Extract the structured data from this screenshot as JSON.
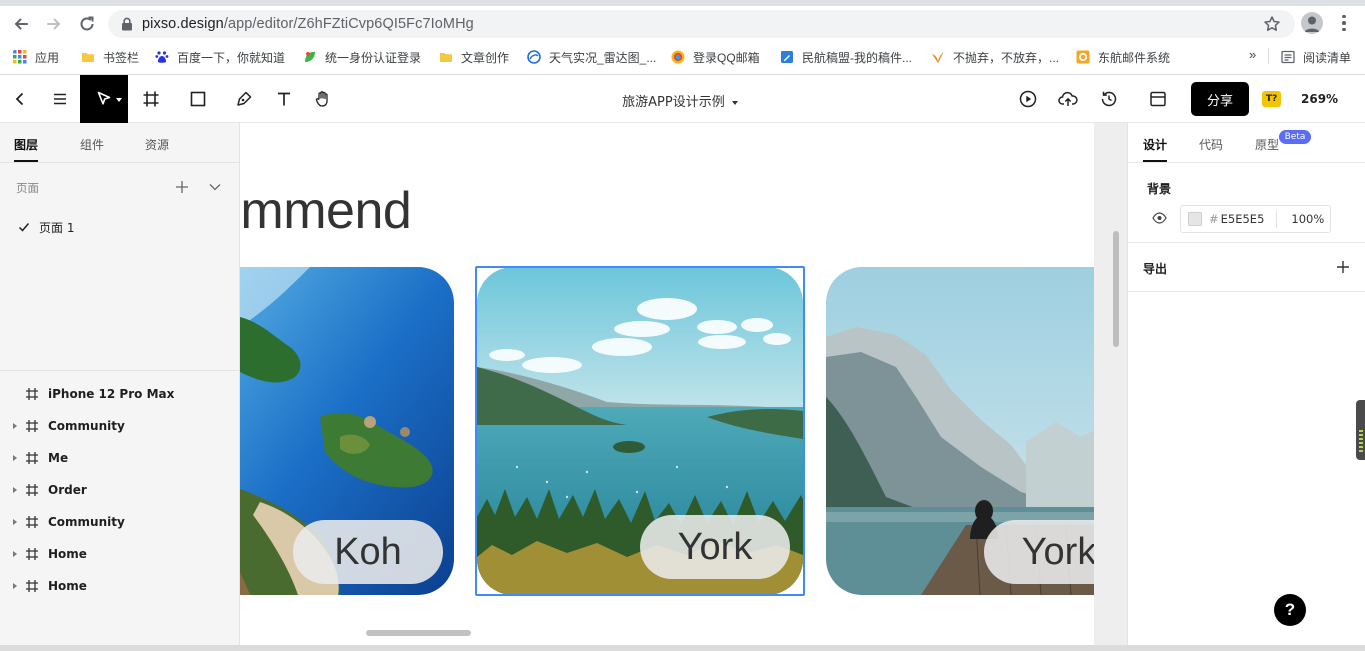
{
  "browser": {
    "url_host": "pixso.design",
    "url_path": "/app/editor/Z6hFZtiCvp6QI5Fc7IoMHg",
    "bookmarks": [
      {
        "label": "应用",
        "icon": "apps-grid-icon",
        "color": "#4285f4"
      },
      {
        "label": "书签栏",
        "icon": "folder-icon",
        "color": "#f5c842"
      },
      {
        "label": "百度一下，你就知道",
        "icon": "baidu-paw-icon",
        "color": "#2932e1"
      },
      {
        "label": "统一身份认证登录",
        "icon": "leaf-icon",
        "color": "#3bb54a"
      },
      {
        "label": "文章创作",
        "icon": "folder-icon",
        "color": "#f5c842"
      },
      {
        "label": "天气实况_雷达图_...",
        "icon": "weather-globe-icon",
        "color": "#1e6fd9"
      },
      {
        "label": "登录QQ邮箱",
        "icon": "qq-mail-icon",
        "color": "#e94b3c"
      },
      {
        "label": "民航稿盟-我的稿件...",
        "icon": "pen-note-icon",
        "color": "#2e7fd9"
      },
      {
        "label": "不抛弃，不放弃，...",
        "icon": "bird-icon",
        "color": "#f08a24"
      },
      {
        "label": "东航邮件系统",
        "icon": "mail-o-icon",
        "color": "#f5a623"
      }
    ],
    "more_label": "»",
    "reading_list": "阅读清单"
  },
  "toolbar": {
    "doc_title": "旅游APP设计示例",
    "share_label": "分享",
    "badge_label": "T?",
    "zoom_label": "269%"
  },
  "left_panel": {
    "tabs": [
      "图层",
      "组件",
      "资源"
    ],
    "pages_label": "页面",
    "pages": [
      "页面 1"
    ],
    "layers": [
      {
        "name": "iPhone 12 Pro Max",
        "expandable": false
      },
      {
        "name": "Community",
        "expandable": true
      },
      {
        "name": "Me",
        "expandable": true
      },
      {
        "name": "Order",
        "expandable": true
      },
      {
        "name": "Community",
        "expandable": true
      },
      {
        "name": "Home",
        "expandable": true
      },
      {
        "name": "Home",
        "expandable": true
      }
    ]
  },
  "canvas": {
    "heading": "ommend",
    "cards": [
      {
        "label": "Koh"
      },
      {
        "label": "York"
      },
      {
        "label": "York"
      }
    ]
  },
  "right_panel": {
    "tabs": [
      "设计",
      "代码",
      "原型"
    ],
    "beta_label": "Beta",
    "background_label": "背景",
    "background_hex": "E5E5E5",
    "background_opacity": "100%",
    "export_label": "导出"
  },
  "help_label": "?",
  "colors": {
    "accent": "#000000",
    "selection": "#3d8bff",
    "beta": "#5b6cf5",
    "badge": "#f5c400"
  }
}
